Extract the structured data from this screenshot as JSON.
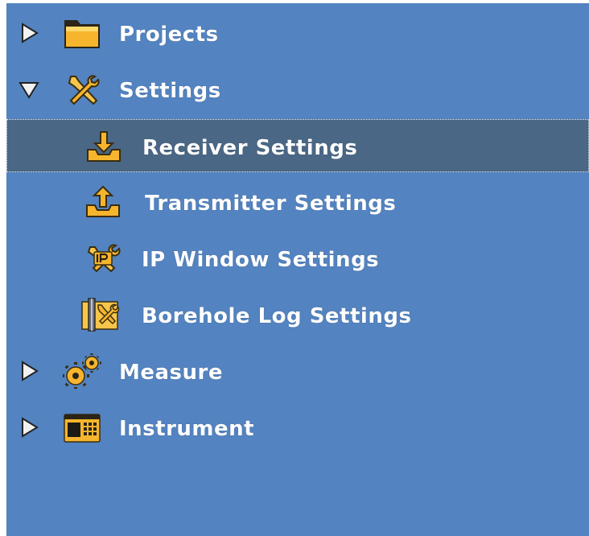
{
  "tree": {
    "projects": {
      "label": "Projects",
      "icon": "folder-icon",
      "expanded": false
    },
    "settings": {
      "label": "Settings",
      "icon": "tools-icon",
      "expanded": true,
      "children": [
        {
          "label": "Receiver Settings",
          "icon": "download-tray-icon",
          "selected": true
        },
        {
          "label": "Transmitter Settings",
          "icon": "upload-tray-icon",
          "selected": false
        },
        {
          "label": "IP Window Settings",
          "icon": "ip-tools-icon",
          "selected": false
        },
        {
          "label": "Borehole Log Settings",
          "icon": "borehole-tools-icon",
          "selected": false
        }
      ]
    },
    "measure": {
      "label": "Measure",
      "icon": "gears-icon",
      "expanded": false
    },
    "instrument": {
      "label": "Instrument",
      "icon": "instrument-panel-icon",
      "expanded": false
    }
  },
  "colors": {
    "background": "#5383c0",
    "selected_row": "#4a6785",
    "text": "#ffffff",
    "icon_accent": "#f5b82e"
  }
}
